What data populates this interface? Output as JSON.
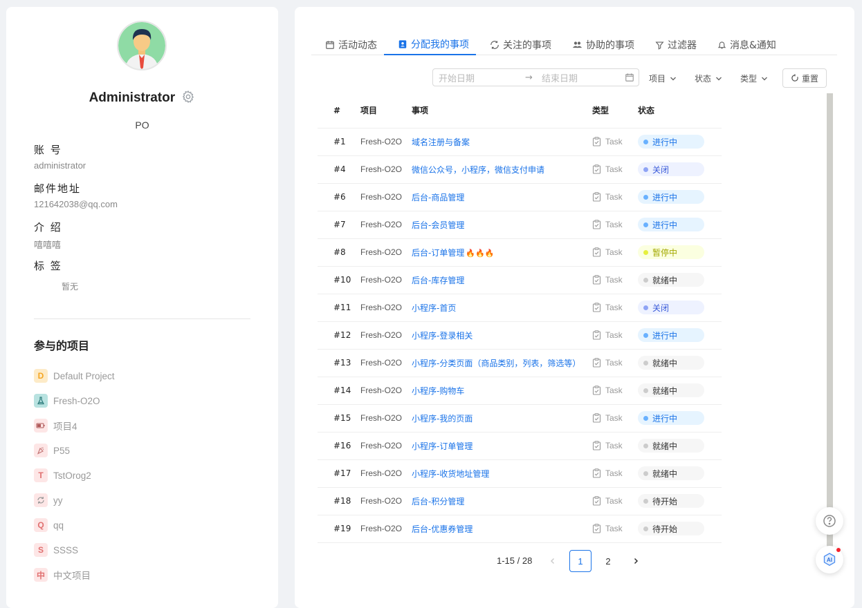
{
  "profile": {
    "name": "Administrator",
    "role": "PO",
    "fields": [
      {
        "label": "账 号",
        "value": "administrator"
      },
      {
        "label": "邮件地址",
        "value": "121642038@qq.com"
      },
      {
        "label": "介 绍",
        "value": "嘻嘻嘻"
      },
      {
        "label": "标 签",
        "value": "暂无"
      }
    ],
    "projects_title": "参与的项目",
    "projects": [
      {
        "badge": "D",
        "name": "Default Project",
        "color": "#f5a623",
        "bg": "#fdebc8"
      },
      {
        "badge": "flask-icon",
        "name": "Fresh-O2O",
        "color": "#2a7a7a",
        "bg": "#b8e2e0"
      },
      {
        "badge": "battery-icon",
        "name": "项目4",
        "color": "#e07070",
        "bg": "#fde6e6"
      },
      {
        "badge": "party-icon",
        "name": "P55",
        "color": "#e07070",
        "bg": "#fde6e6"
      },
      {
        "badge": "T",
        "name": "TstOrog2",
        "color": "#e07070",
        "bg": "#fde6e6"
      },
      {
        "badge": "refresh-icon",
        "name": "yy",
        "color": "#e07070",
        "bg": "#fde6e6"
      },
      {
        "badge": "Q",
        "name": "qq",
        "color": "#e07070",
        "bg": "#fde6e6"
      },
      {
        "badge": "S",
        "name": "SSSS",
        "color": "#e07070",
        "bg": "#fde6e6"
      },
      {
        "badge": "中",
        "name": "中文项目",
        "color": "#e07070",
        "bg": "#fde6e6"
      }
    ]
  },
  "tabs": [
    {
      "label": "活动动态",
      "icon": "calendar-icon"
    },
    {
      "label": "分配我的事项",
      "icon": "assigned-icon",
      "active": true
    },
    {
      "label": "关注的事项",
      "icon": "watch-icon"
    },
    {
      "label": "协助的事项",
      "icon": "team-icon"
    },
    {
      "label": "过滤器",
      "icon": "filter-icon"
    },
    {
      "label": "消息&通知",
      "icon": "bell-icon"
    }
  ],
  "filters": {
    "start_placeholder": "开始日期",
    "end_placeholder": "结束日期",
    "project": "项目",
    "status": "状态",
    "type": "类型",
    "reset": "重置"
  },
  "table": {
    "headers": {
      "id": "#",
      "project": "项目",
      "title": "事项",
      "type": "类型",
      "status": "状态"
    },
    "rows": [
      {
        "id": "#1",
        "project": "Fresh-O2O",
        "title": "域名注册与备案",
        "type": "Task",
        "status": "进行中",
        "status_kind": "progress"
      },
      {
        "id": "#4",
        "project": "Fresh-O2O",
        "title": "微信公众号，小程序，微信支付申请",
        "type": "Task",
        "status": "关闭",
        "status_kind": "closed"
      },
      {
        "id": "#6",
        "project": "Fresh-O2O",
        "title": "后台-商品管理",
        "type": "Task",
        "status": "进行中",
        "status_kind": "progress"
      },
      {
        "id": "#7",
        "project": "Fresh-O2O",
        "title": "后台-会员管理",
        "type": "Task",
        "status": "进行中",
        "status_kind": "progress"
      },
      {
        "id": "#8",
        "project": "Fresh-O2O",
        "title": "后台-订单管理",
        "fire": "🔥🔥🔥",
        "type": "Task",
        "status": "暂停中",
        "status_kind": "paused"
      },
      {
        "id": "#10",
        "project": "Fresh-O2O",
        "title": "后台-库存管理",
        "type": "Task",
        "status": "就绪中",
        "status_kind": "ready"
      },
      {
        "id": "#11",
        "project": "Fresh-O2O",
        "title": "小程序-首页",
        "type": "Task",
        "status": "关闭",
        "status_kind": "closed"
      },
      {
        "id": "#12",
        "project": "Fresh-O2O",
        "title": "小程序-登录相关",
        "type": "Task",
        "status": "进行中",
        "status_kind": "progress"
      },
      {
        "id": "#13",
        "project": "Fresh-O2O",
        "title": "小程序-分类页面（商品类别，列表，筛选等）",
        "type": "Task",
        "status": "就绪中",
        "status_kind": "ready"
      },
      {
        "id": "#14",
        "project": "Fresh-O2O",
        "title": "小程序-购物车",
        "type": "Task",
        "status": "就绪中",
        "status_kind": "ready"
      },
      {
        "id": "#15",
        "project": "Fresh-O2O",
        "title": "小程序-我的页面",
        "type": "Task",
        "status": "进行中",
        "status_kind": "progress"
      },
      {
        "id": "#16",
        "project": "Fresh-O2O",
        "title": "小程序-订单管理",
        "type": "Task",
        "status": "就绪中",
        "status_kind": "ready"
      },
      {
        "id": "#17",
        "project": "Fresh-O2O",
        "title": "小程序-收货地址管理",
        "type": "Task",
        "status": "就绪中",
        "status_kind": "ready"
      },
      {
        "id": "#18",
        "project": "Fresh-O2O",
        "title": "后台-积分管理",
        "type": "Task",
        "status": "待开始",
        "status_kind": "ready"
      },
      {
        "id": "#19",
        "project": "Fresh-O2O",
        "title": "后台-优惠券管理",
        "type": "Task",
        "status": "待开始",
        "status_kind": "ready"
      }
    ]
  },
  "pagination": {
    "total": "1-15 / 28",
    "pages": [
      "1",
      "2"
    ],
    "current": "1"
  },
  "float": {
    "help_icon": "help-icon",
    "ai_icon": "ai-assistant-icon",
    "ai_label": "AI"
  }
}
